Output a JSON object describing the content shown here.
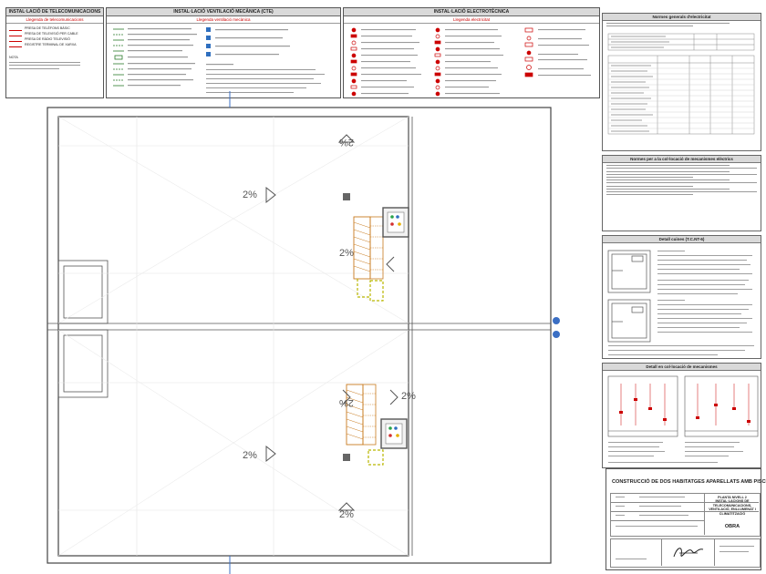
{
  "legends": {
    "telecom": {
      "title": "INSTAL·LACIÓ DE TELECOMUNICACIONS",
      "subtitle": "Llegenda de telecomunicacions",
      "items": [
        "PRESA DE TELÈFONS BÀSIC",
        "PRESA DE TELEVISIÓ PER CABLE",
        "PRESA DE RÀDIO TELEVISIÓ",
        "REGISTRE TERMINAL DE XARXA"
      ],
      "extra": "NOTA"
    },
    "ventilation": {
      "title": "INSTAL·LACIÓ VENTILACIÓ MECÀNICA (CTE)",
      "subtitle": "Llegenda ventilació mecànica"
    },
    "electrical": {
      "title": "INSTAL·LACIÓ ELECTROTÈCNICA",
      "subtitle": "Llegenda electricitat"
    }
  },
  "right_panel": {
    "section1_title": "Normes generals d'electricitat",
    "section2_title": "Normes per a la col·locació de mecanismes elèctrics",
    "section3_title": "Detall cuines (T.C.NT-6)",
    "section4_title": "Detall en col·locació de mecanismes"
  },
  "plan": {
    "slope_labels": [
      "2%",
      "2%",
      "2%",
      "2%",
      "2%",
      "2%",
      "2%"
    ]
  },
  "title_block": {
    "project": "CONSTRUCCIÓ DE DOS HABITATGES APARELLATS AMB PISCINES",
    "drawing": "PLANTA NIVELL 2 INSTAL·LACIONS DE TELECOMUNICACIONS, VENTILACIÓ, ENLLUMENAT I CLIMATITZACIÓ",
    "phase": "OBRA"
  }
}
